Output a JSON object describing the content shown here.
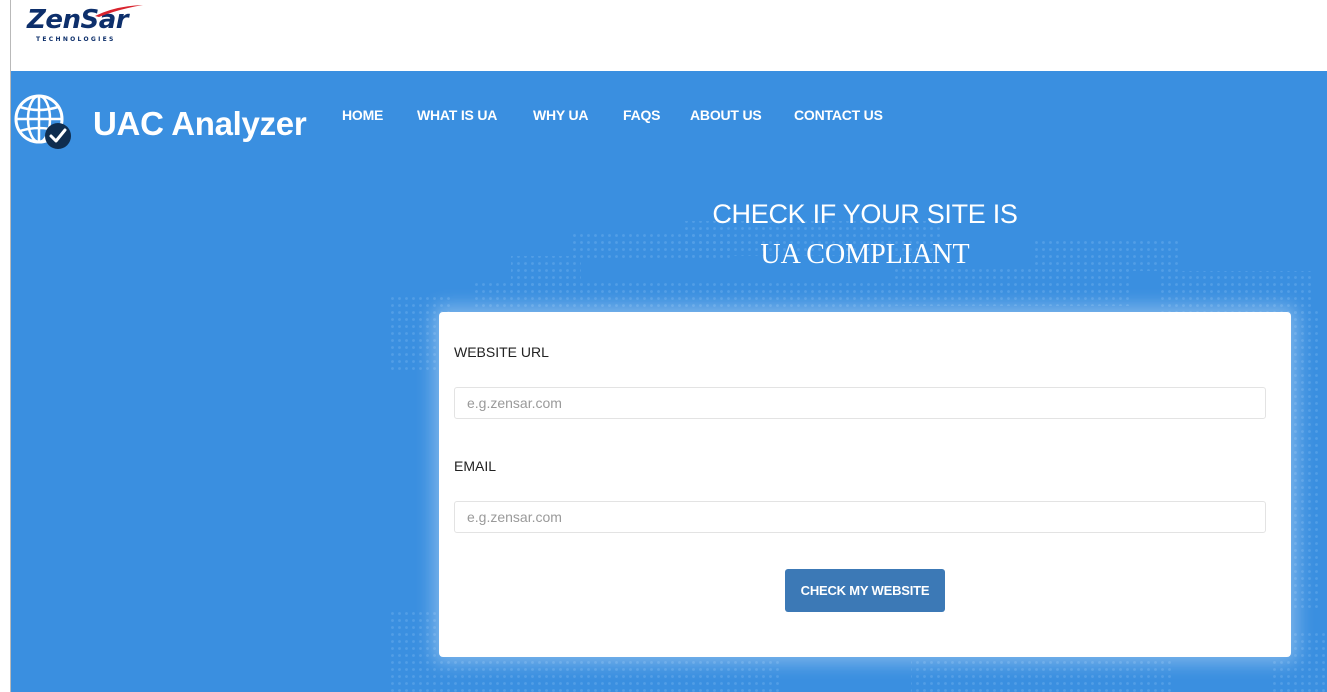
{
  "company": {
    "logo_text": "ZenSar",
    "logo_subtitle": "TECHNOLOGIES"
  },
  "brand": {
    "name": "UAC Analyzer",
    "icon": "globe-check-icon"
  },
  "nav": {
    "items": [
      "HOME",
      "WHAT IS UA",
      "WHY UA",
      "FAQS",
      "ABOUT US",
      "CONTACT US"
    ]
  },
  "hero": {
    "headline": "CHECK IF YOUR SITE IS",
    "subline": "UA COMPLIANT"
  },
  "form": {
    "url_label": "WEBSITE URL",
    "url_placeholder": "e.g.zensar.com",
    "url_value": "",
    "email_label": "EMAIL",
    "email_placeholder": "e.g.zensar.com",
    "email_value": "",
    "submit_label": "CHECK MY WEBSITE"
  },
  "colors": {
    "hero_background": "#3a8fe0",
    "button": "#3c79b6",
    "logo": "#0d2f6b",
    "logo_accent": "#d9232e"
  }
}
